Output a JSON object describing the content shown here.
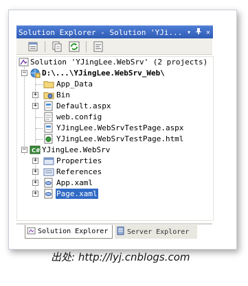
{
  "panel": {
    "title": "Solution Explorer - Solution 'YJi...",
    "dropdown_glyph": "▾",
    "pin_glyph": "ᵖ",
    "close_glyph": "✕"
  },
  "toolbar": {
    "icons": [
      "properties-icon",
      "show-all-files-icon",
      "refresh-icon",
      "view-code-icon"
    ]
  },
  "tree": {
    "solution": "Solution 'YJingLee.WebSrv' (2 projects)",
    "web_project": "D:\\...\\YJingLee.WebSrv_Web\\",
    "web_items": [
      "App_Data",
      "Bin",
      "Default.aspx",
      "web.config",
      "YJingLee.WebSrvTestPage.aspx",
      "YJingLee.WebSrvTestPage.html"
    ],
    "silverlight_project": "YJingLee.WebSrv",
    "sl_items": [
      "Properties",
      "References",
      "App.xaml",
      "Page.xaml"
    ],
    "selected_item": "Page.xaml"
  },
  "tabs": [
    {
      "label": "Solution Explorer",
      "active": true
    },
    {
      "label": "Server Explorer",
      "active": false
    }
  ],
  "caption": "出处: http://lyj.cnblogs.com",
  "colors": {
    "title_bar": "#3a66c2",
    "selection": "#316ac5",
    "toolbar": "#f0efe9"
  }
}
